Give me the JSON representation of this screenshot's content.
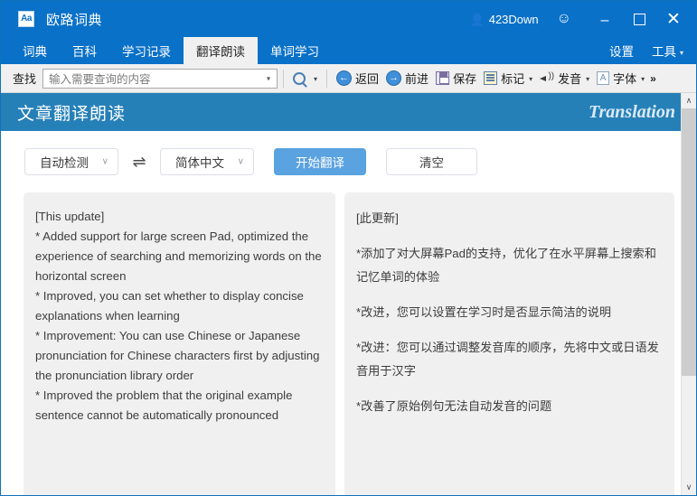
{
  "titlebar": {
    "app_icon_text": "Aa",
    "app_icon_name": "app-logo-icon",
    "title": "欧路词典",
    "user": "423Down",
    "user_icon": "person-icon",
    "smiley_icon": "smiley-face-icon",
    "minimize_label": "–",
    "maximize_label": "",
    "close_label": "✕",
    "bg_color": "#0a71c8"
  },
  "menubar": {
    "tabs": [
      {
        "label": "词典",
        "active": false
      },
      {
        "label": "百科",
        "active": false
      },
      {
        "label": "学习记录",
        "active": false
      },
      {
        "label": "翻译朗读",
        "active": true
      },
      {
        "label": "单词学习",
        "active": false
      }
    ],
    "right_items": [
      {
        "label": "设置",
        "has_caret": false
      },
      {
        "label": "工具",
        "has_caret": true
      }
    ],
    "caret": "▾"
  },
  "toolbar": {
    "find_label": "查找",
    "search_placeholder": "输入需要查询的内容",
    "search_value": "",
    "combo_caret": "▾",
    "items": [
      {
        "label": "",
        "icon": "magnifier-icon",
        "dropdown": true
      },
      {
        "label": "返回",
        "icon": "back-arrow-icon",
        "dropdown": false
      },
      {
        "label": "前进",
        "icon": "forward-arrow-icon",
        "dropdown": false
      },
      {
        "label": "保存",
        "icon": "save-disk-icon",
        "dropdown": false
      },
      {
        "label": "标记",
        "icon": "mark-note-icon",
        "dropdown": true
      },
      {
        "label": "发音",
        "icon": "speaker-icon",
        "dropdown": true
      },
      {
        "label": "字体",
        "icon": "font-icon",
        "dropdown": true
      }
    ],
    "overflow_label": "»",
    "back_glyph": "←",
    "forward_glyph": "→"
  },
  "banner": {
    "title": "文章翻译朗读",
    "subtitle": "Translation",
    "bg_color": "#2680b8"
  },
  "controls": {
    "source_lang": "自动检测",
    "target_lang": "简体中文",
    "swap_icon": "⇌",
    "swap_icon_name": "swap-languages-icon",
    "translate_button": "开始翻译",
    "clear_button": "清空",
    "chevron": "∨",
    "primary_color": "#5aa2e0"
  },
  "panes": {
    "source": {
      "name": "source-text-pane",
      "lines": [
        "[This update]",
        "* Added support for large screen Pad, optimized the experience of searching and memorizing words on the horizontal screen",
        "* Improved, you can set whether to display concise explanations when learning",
        "* Improvement: You can use Chinese or Japanese pronunciation for Chinese characters first by adjusting the pronunciation library order",
        "* Improved the problem that the original example sentence cannot be automatically pronounced"
      ]
    },
    "target": {
      "name": "target-text-pane",
      "lines": [
        "[此更新]",
        "",
        "*添加了对大屏幕Pad的支持，优化了在水平屏幕上搜索和记忆单词的体验",
        "",
        "*改进，您可以设置在学习时是否显示简洁的说明",
        "",
        "*改进：您可以通过调整发音库的顺序，先将中文或日语发音用于汉字",
        "",
        "*改善了原始例句无法自动发音的问题"
      ]
    }
  },
  "scrollbar": {
    "up_arrow": "∧",
    "down_arrow": "∨",
    "thumb_position_percent": 0
  }
}
